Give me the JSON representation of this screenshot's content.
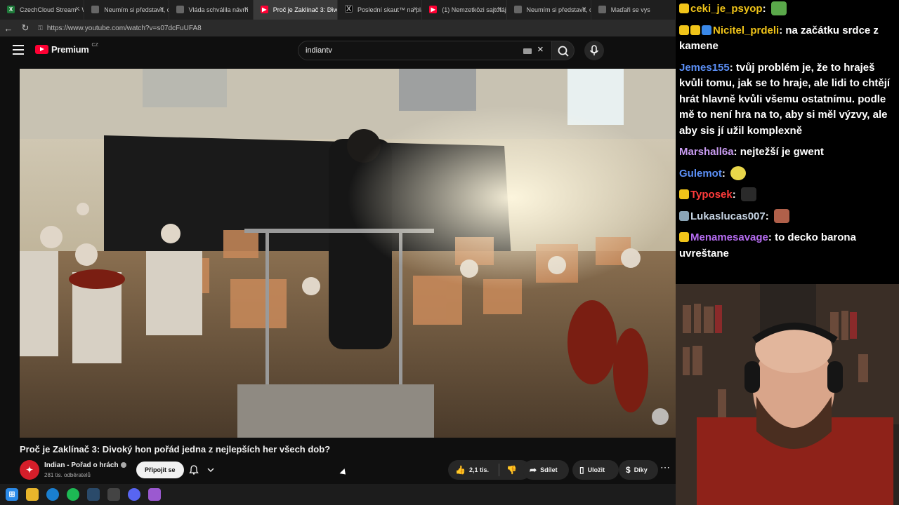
{
  "browser": {
    "tabs": [
      {
        "label": "CzechCloud Stream - W",
        "favicon": "spreadsheet-icon",
        "active": false
      },
      {
        "label": "Neumím si představit, c",
        "favicon": "document-icon",
        "active": false
      },
      {
        "label": "Vláda schválila návrh",
        "favicon": "document-icon",
        "active": false
      },
      {
        "label": "Proč je Zaklínač 3: Divoký",
        "favicon": "youtube-icon",
        "active": true
      },
      {
        "label": "Poslední skaut™ na platf",
        "favicon": "x-icon",
        "active": false
      },
      {
        "label": "(1) Nemzetközi sajtótáj",
        "favicon": "youtube-icon",
        "active": false
      },
      {
        "label": "Neumím si představit, c",
        "favicon": "document-icon",
        "active": false
      },
      {
        "label": "Maďaři se vys",
        "favicon": "document-icon",
        "active": false
      }
    ],
    "url": "https://www.youtube.com/watch?v=s07dcFuUFA8"
  },
  "youtube": {
    "logo_text": "Premium",
    "region": "CZ",
    "search_value": "indiantv",
    "video_title": "Proč je Zaklínač 3: Divoký hon pořád jedna z nejlepších her všech dob?",
    "channel_name": "Indian - Pořad o hrách",
    "subscribers": "281 tis. odběratelů",
    "join_label": "Připojit se",
    "like_count": "2,1 tis.",
    "share_label": "Sdílet",
    "save_label": "Uložit",
    "thanks_label": "Díky",
    "accent": "#ff0033"
  },
  "chat": {
    "messages": [
      {
        "user": "ceki_je_psyop",
        "color": "#f0c419",
        "text": ""
      },
      {
        "user": "Nicitel_prdeli",
        "color": "#f0c419",
        "text": "na začátku srdce z kamene"
      },
      {
        "user": "Jemes155",
        "color": "#5b8ff5",
        "text": "tvůj problém je, že to hraješ kvůli tomu, jak se to hraje, ale lidi to chtějí hrát hlavně kvůli všemu ostatnímu. podle mě to není hra na to, aby si měl výzvy, ale aby sis jí užil komplexně"
      },
      {
        "user": "Marshall6a",
        "color": "#c89bf0",
        "text": "nejtežší je gwent"
      },
      {
        "user": "Gulemot",
        "color": "#5b8ff5",
        "text": ""
      },
      {
        "user": "Typosek",
        "color": "#ff3b3b",
        "text": ""
      },
      {
        "user": "Lukaslucas007",
        "color": "#c8d6e5",
        "text": ""
      },
      {
        "user": "Menamesavage",
        "color": "#b56cf0",
        "text": "to decko barona uvreštane"
      }
    ]
  }
}
